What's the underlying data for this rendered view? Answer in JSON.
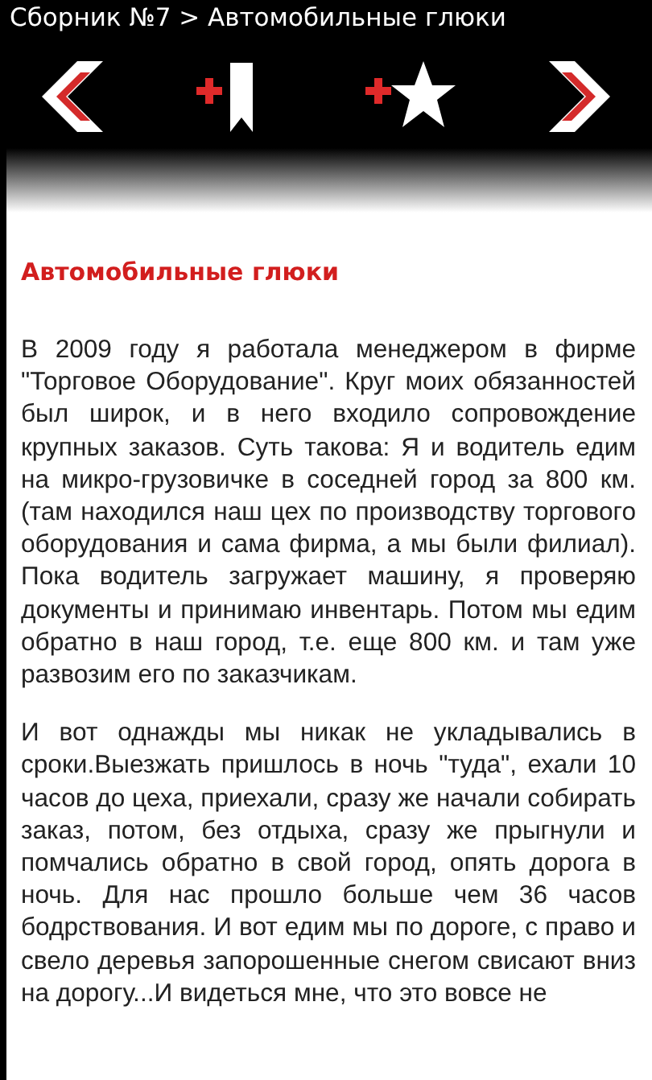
{
  "header": {
    "title": "Сборник №7 > Автомобильные глюки"
  },
  "toolbar": {
    "buttons": [
      {
        "kind": "prev"
      },
      {
        "kind": "add-bookmark"
      },
      {
        "kind": "add-favorite"
      },
      {
        "kind": "next"
      }
    ]
  },
  "article": {
    "title": "Автомобильные глюки",
    "paragraphs": [
      "В 2009 году я работала менеджером в фирме \"Торговое Оборудование\". Круг моих обязанностей был широк, и в него входило сопровождение крупных заказов. Суть такова: Я и водитель едим на микро-грузовичке в соседней город за 800 км.(там находился наш цех по производству торгового оборудования и сама фирма, а мы были филиал). Пока водитель загружает машину, я проверяю документы и принимаю инвентарь. Потом мы едим обратно в наш город, т.е. еще 800 км. и там уже развозим его по заказчикам.",
      "И вот однажды мы никак не укладывались в сроки.Выезжать пришлось в ночь \"туда\", ехали 10 часов до цеха, приехали, сразу же начали собирать заказ, потом, без отдыха, сразу же прыгнули и помчались обратно в свой город, опять дорога в ночь. Для нас прошло больше чем 36 часов бодрствования. И вот едим мы по дороге, с право и свело деревья запорошенные снегом свисают вниз на дорогу...И видеться мне, что это вовсе не"
    ]
  }
}
